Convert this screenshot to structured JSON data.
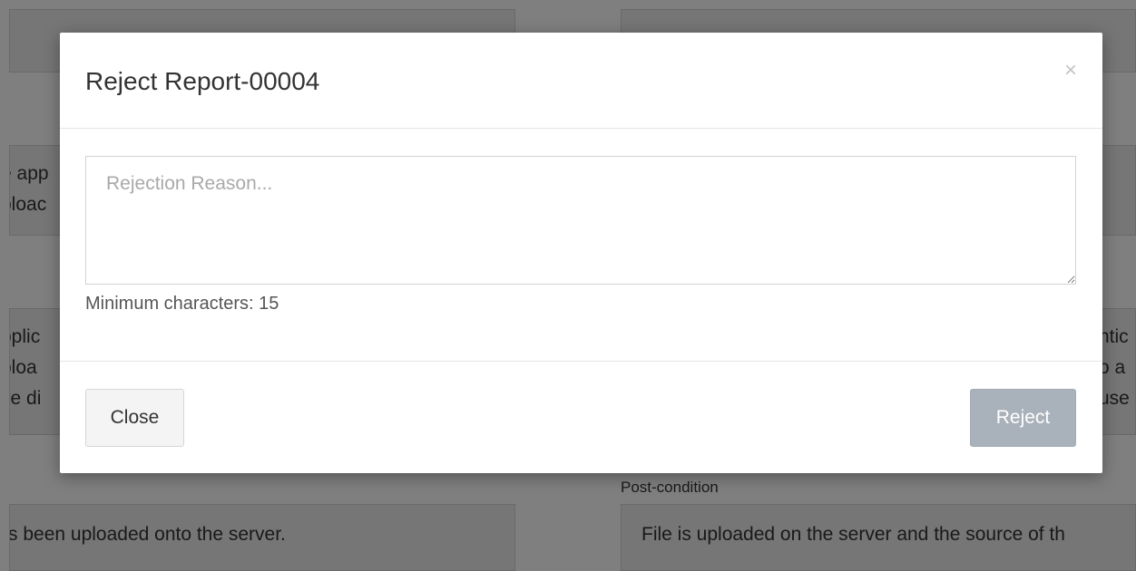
{
  "background": {
    "left_fragment_1": "e app",
    "left_fragment_2": "ploac",
    "left_fragment_3": "pplic",
    "left_fragment_4": "ploa",
    "left_fragment_5": "ve di",
    "right_fragment_1": "ntic",
    "right_fragment_2": "o a",
    "right_fragment_3": "use",
    "postcondition_label": "Post-condition",
    "left_bottom_text": "s been uploaded onto the server.",
    "right_bottom_text": "File is uploaded on the server and the source of th"
  },
  "modal": {
    "title": "Reject Report-00004",
    "close_icon": "×",
    "textarea_placeholder": "Rejection Reason...",
    "min_chars_label": "Minimum characters: 15",
    "close_button": "Close",
    "reject_button": "Reject"
  },
  "colors": {
    "reject_button_disabled": "#a9b1ba",
    "close_button_bg": "#f4f4f4"
  }
}
